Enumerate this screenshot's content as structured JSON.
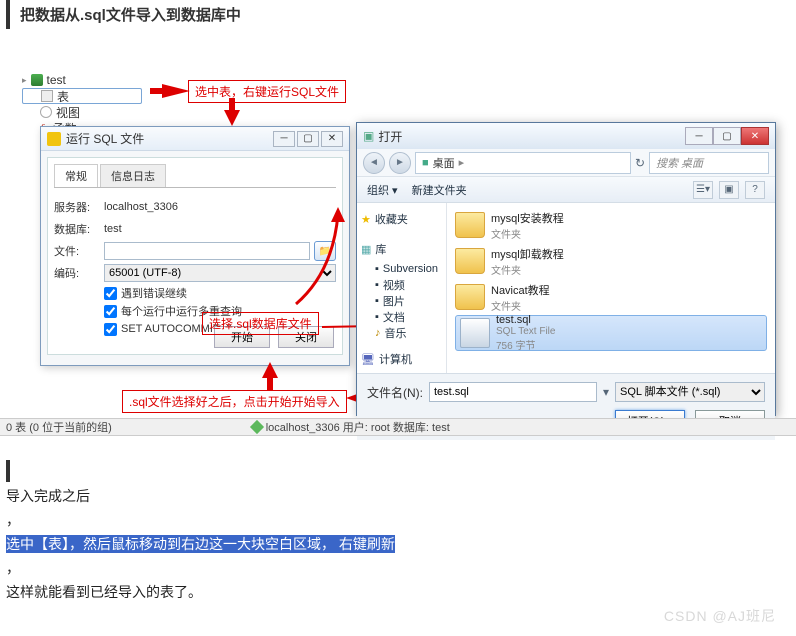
{
  "doc": {
    "title": "把数据从.sql文件导入到数据库中",
    "post1": "导入完成之后",
    "post_comma1": "，",
    "post2": "选中【表】，然后鼠标移动到右边这一大块空白区域，  右键刷新",
    "post_comma2": "，",
    "post3": "这样就能看到已经导入的表了。",
    "watermark": "CSDN @AJ班尼"
  },
  "tree": {
    "db": "test",
    "table": "表",
    "view": "视图",
    "func": "函数"
  },
  "annotations": {
    "a1": "选中表，右键运行SQL文件",
    "a2": "选择.sql数据库文件",
    "a3": ".sql文件选择好之后，点击开始开始导入"
  },
  "run_dialog": {
    "title": "运行 SQL 文件",
    "tab_general": "常规",
    "tab_log": "信息日志",
    "lbl_server": "服务器:",
    "val_server": "localhost_3306",
    "lbl_db": "数据库:",
    "val_db": "test",
    "lbl_file": "文件:",
    "val_file": "",
    "lbl_encoding": "编码:",
    "val_encoding": "65001 (UTF-8)",
    "chk1": "遇到错误继续",
    "chk2": "每个运行中运行多重查询",
    "chk3": "SET AUTOCOMMIT=0",
    "btn_start": "开始",
    "btn_close": "关闭"
  },
  "open_dialog": {
    "title": "打开",
    "path_seg1": "桌面",
    "search_placeholder": "搜索 桌面",
    "org": "组织",
    "newfolder": "新建文件夹",
    "side": {
      "fav": "收藏夹",
      "lib": "库",
      "sub": "Subversion",
      "vid": "视频",
      "pic": "图片",
      "doc": "文档",
      "music": "音乐",
      "computer": "计算机"
    },
    "files": {
      "f1_name": "mysql安装教程",
      "f1_sub": "文件夹",
      "f2_name": "mysql卸载教程",
      "f2_sub": "文件夹",
      "f3_name": "Navicat教程",
      "f3_sub": "文件夹",
      "f4_name": "test.sql",
      "f4_sub1": "SQL Text File",
      "f4_sub2": "756 字节"
    },
    "filename_lbl": "文件名(N):",
    "filename_val": "test.sql",
    "filter": "SQL 脚本文件 (*.sql)",
    "btn_open": "打开(O)",
    "btn_cancel": "取消"
  },
  "status": {
    "left": "0 表 (0 位于当前的组)",
    "mid": "localhost_3306   用户: root   数据库: test"
  }
}
